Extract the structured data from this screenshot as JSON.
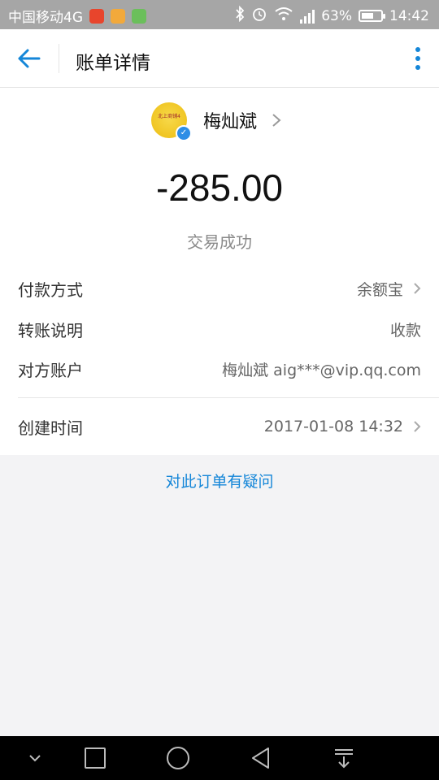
{
  "status_bar": {
    "carrier": "中国移动4G",
    "battery_percent": "63%",
    "battery_level": 0.63,
    "time": "14:42",
    "network_type": "4G",
    "icons": [
      "sogou-icon",
      "notification-icon",
      "app-icon",
      "bluetooth-icon",
      "alarm-icon",
      "wifi-icon",
      "signal-icon",
      "battery-icon"
    ]
  },
  "header": {
    "title": "账单详情",
    "back_icon": "back-arrow-icon",
    "more_icon": "more-vertical-icon",
    "accent_color": "#1486d8"
  },
  "payee": {
    "name": "梅灿斌",
    "avatar_text": "北上商铺4"
  },
  "transaction": {
    "amount": "-285.00",
    "status": "交易成功"
  },
  "details": [
    {
      "label": "付款方式",
      "value": "余额宝"
    },
    {
      "label": "转账说明",
      "value": "收款"
    },
    {
      "label": "对方账户",
      "value": "梅灿斌 aig***@vip.qq.com"
    },
    {
      "label": "创建时间",
      "value": "2017-01-08 14:32"
    }
  ],
  "question_link": "对此订单有疑问",
  "nav": [
    "chevron-down-icon",
    "recents-square-icon",
    "home-circle-icon",
    "back-triangle-icon",
    "notification-pull-icon"
  ]
}
